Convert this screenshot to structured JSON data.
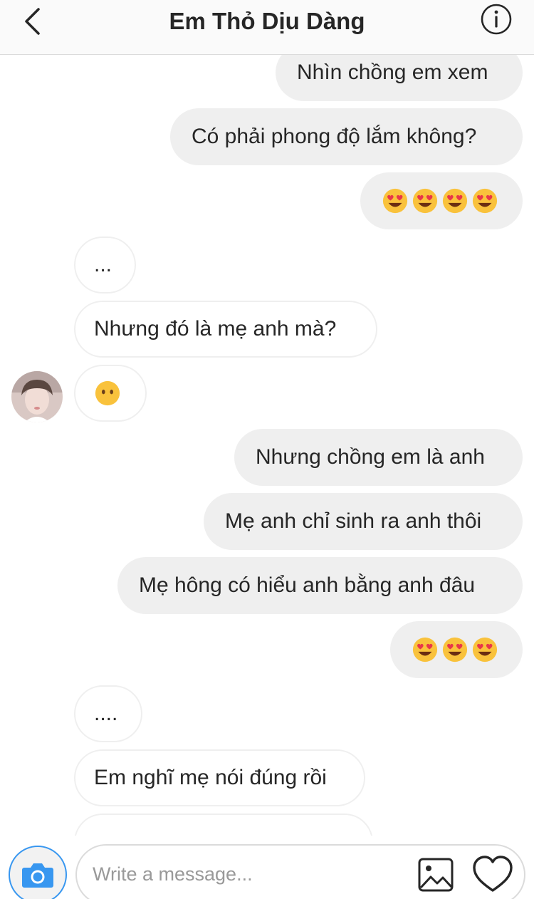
{
  "header": {
    "title": "Em Thỏ Dịu Dàng",
    "back_icon": "chevron-left-icon",
    "info_icon": "info-circle-icon"
  },
  "messages": [
    {
      "from": "me",
      "text": "Nhìn chồng em xem"
    },
    {
      "from": "me",
      "text": "Có phải phong độ lắm không?"
    },
    {
      "from": "me",
      "emoji": "heart-eyes-face",
      "count": 4
    },
    {
      "from": "them",
      "text": "..."
    },
    {
      "from": "them",
      "text": "Nhưng đó là mẹ anh mà?"
    },
    {
      "from": "them",
      "emoji": "face-without-mouth",
      "count": 1,
      "avatar": true
    },
    {
      "from": "me",
      "text": "Nhưng chồng em là anh"
    },
    {
      "from": "me",
      "text": "Mẹ anh chỉ sinh ra anh thôi"
    },
    {
      "from": "me",
      "text": "Mẹ hông có hiểu anh bằng anh đâu"
    },
    {
      "from": "me",
      "emoji": "heart-eyes-face",
      "count": 3
    },
    {
      "from": "them",
      "text": "...."
    },
    {
      "from": "them",
      "text": "Em nghĩ mẹ nói đúng rồi"
    }
  ],
  "composer": {
    "placeholder": "Write a message...",
    "value": "",
    "camera_icon": "camera-icon",
    "gallery_icon": "gallery-icon",
    "like_icon": "heart-icon"
  },
  "colors": {
    "sent_bubble": "#efefef",
    "received_border": "#efefef",
    "camera_ring": "#3897f0",
    "camera_icon": "#3897f0",
    "text": "#262626",
    "placeholder": "#999999"
  }
}
